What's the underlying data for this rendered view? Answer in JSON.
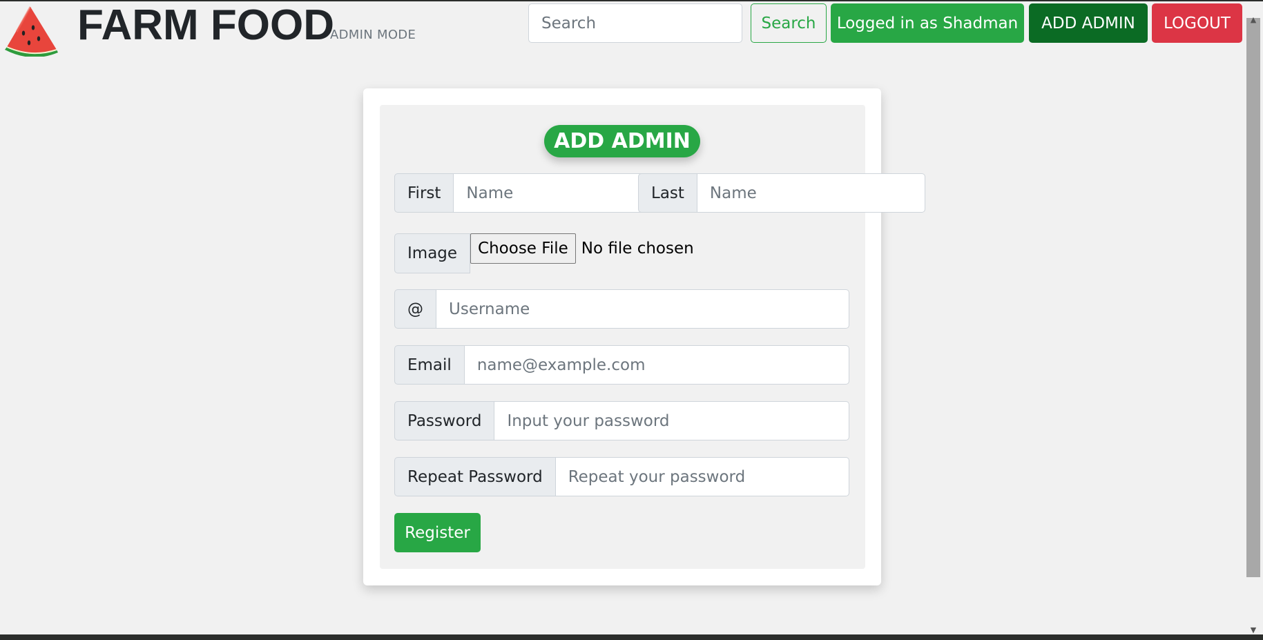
{
  "header": {
    "brand": "FARM FOOD",
    "brand_sub": "ADMIN MODE",
    "search_placeholder": "Search",
    "search_button": "Search",
    "logged_in": "Logged in as Shadman",
    "add_admin": "ADD ADMIN",
    "logout": "LOGOUT"
  },
  "form": {
    "title": "ADD ADMIN",
    "first_label": "First",
    "first_placeholder": "Name",
    "last_label": "Last",
    "last_placeholder": "Name",
    "image_label": "Image",
    "file_button": "Choose File",
    "file_status": "No file chosen",
    "username_addon": "@",
    "username_placeholder": "Username",
    "email_label": "Email",
    "email_placeholder": "name@example.com",
    "password_label": "Password",
    "password_placeholder": "Input your password",
    "repeat_label": "Repeat Password",
    "repeat_placeholder": "Repeat your password",
    "register": "Register"
  },
  "colors": {
    "green": "#28a745",
    "dark_green": "#0b6b24",
    "red": "#dc3545",
    "background": "#f1f1f1"
  }
}
